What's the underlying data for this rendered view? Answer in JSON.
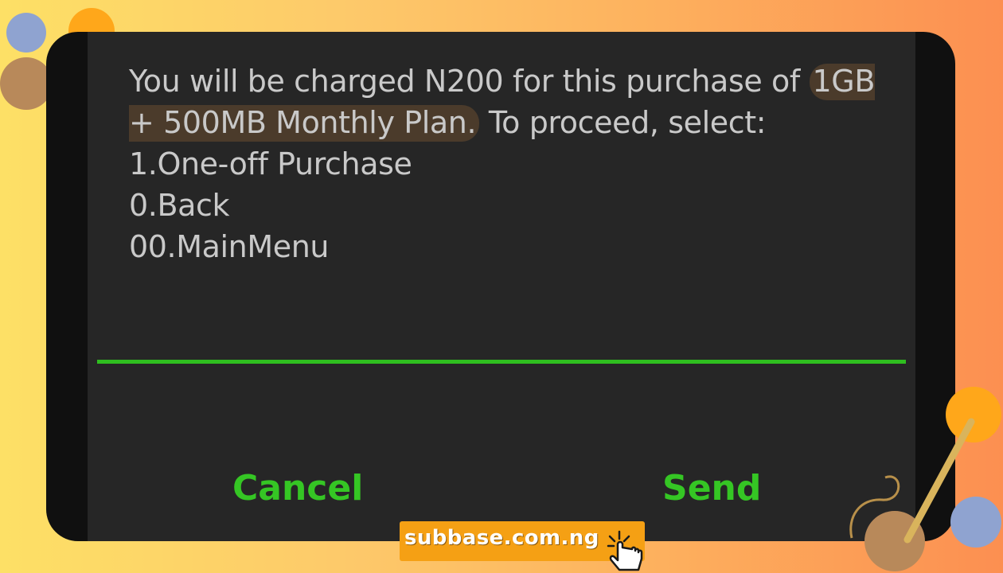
{
  "dialog": {
    "message": {
      "part1": "You will be charged N200 for this purchase of ",
      "highlight": "1GB + 500MB Monthly Plan.",
      "part2": " To proceed, select:",
      "options": [
        "1.One-off Purchase",
        "0.Back",
        "00.MainMenu"
      ]
    },
    "cancel_label": "Cancel",
    "send_label": "Send"
  },
  "watermark": {
    "text": "subbase.com.ng"
  },
  "colors": {
    "accent_green": "#35c624",
    "dialog_bg": "#262626",
    "text": "#c9c9c9",
    "highlight_bg": "#4b3b2b",
    "watermark_bg": "#f5a014"
  },
  "icons": [
    "pointing-hand-icon"
  ]
}
